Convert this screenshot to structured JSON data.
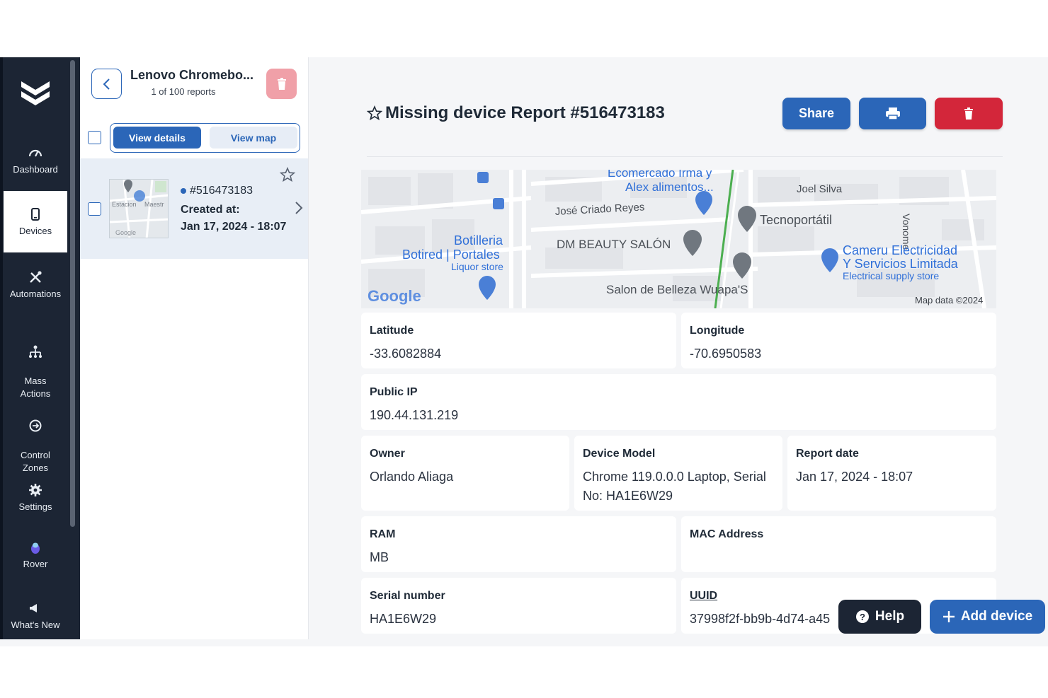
{
  "sidebar": {
    "items": [
      {
        "label": "Dashboard",
        "icon": "gauge-icon"
      },
      {
        "label": "Devices",
        "icon": "phone-icon",
        "active": true
      },
      {
        "label": "Automations",
        "icon": "tools-icon"
      },
      {
        "label": "Mass\nActions",
        "icon": "hierarchy-icon"
      },
      {
        "label": "Control\nZones",
        "icon": "zone-icon"
      },
      {
        "label": "Settings",
        "icon": "gear-icon"
      },
      {
        "label": "Rover",
        "icon": "rover-icon"
      },
      {
        "label": "What's New",
        "icon": "megaphone-icon"
      }
    ]
  },
  "list": {
    "title": "Lenovo Chromebo...",
    "subtitle": "1 of 100 reports",
    "view_details_label": "View details",
    "view_map_label": "View map",
    "report": {
      "id": "#516473183",
      "created_label": "Created at:",
      "created_date": "Jan 17, 2024 - 18:07"
    },
    "thumb": {
      "text1": "Estacion",
      "text2": "Maestr",
      "brand": "Google"
    }
  },
  "main": {
    "title": "Missing device Report #516473183",
    "share_label": "Share",
    "map": {
      "labels": [
        "Ecomercado Irma y",
        "Alex alimentos...",
        "Joel Silva",
        "Vonome",
        "José Criado Reyes",
        "Tecnoportátil",
        "DM BEAUTY SALÓN",
        "Botilleria",
        "Botired | Portales",
        "Liquor store",
        "Cameru Electricidad",
        "Y Servicios Limitada",
        "Electrical supply store",
        "Salon de Belleza Wuapa'S"
      ],
      "brand": "Google",
      "credit": "Map data ©2024"
    },
    "fields": {
      "latitude": {
        "label": "Latitude",
        "value": "-33.6082884"
      },
      "longitude": {
        "label": "Longitude",
        "value": "-70.6950583"
      },
      "public_ip": {
        "label": "Public IP",
        "value": "190.44.131.219"
      },
      "owner": {
        "label": "Owner",
        "value": "Orlando Aliaga"
      },
      "device_model": {
        "label": "Device Model",
        "value": "Chrome 119.0.0.0 Laptop, Serial No: HA1E6W29"
      },
      "report_date": {
        "label": "Report date",
        "value": "Jan 17, 2024 - 18:07"
      },
      "ram": {
        "label": "RAM",
        "value": "MB"
      },
      "mac": {
        "label": "MAC Address",
        "value": ""
      },
      "serial": {
        "label": "Serial number",
        "value": "HA1E6W29"
      },
      "uuid": {
        "label": "UUID",
        "value": "37998f2f-bb9b-4d74-a45"
      }
    },
    "help_label": "Help",
    "add_device_label": "Add device"
  },
  "colors": {
    "primary": "#2b66b8",
    "danger": "#d3263a",
    "sidebar_bg": "#1c2534"
  }
}
